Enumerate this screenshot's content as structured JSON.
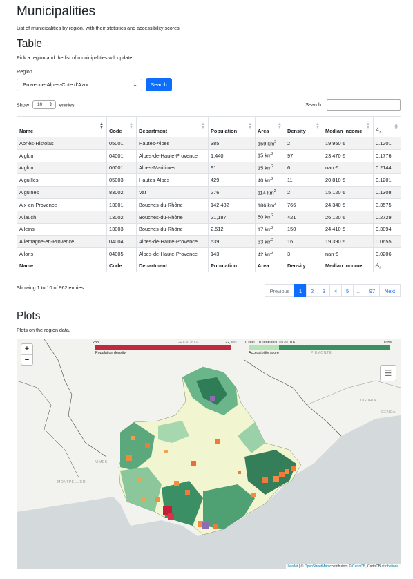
{
  "page": {
    "title": "Municipalities",
    "subtitle": "List of municipalities by region, with their statistics and accessibility scores."
  },
  "table_section": {
    "heading": "Table",
    "description": "Pick a region and the list of municipalities will update.",
    "region_label": "Region",
    "region_value": "Provence-Alpes-Cote d'Azur",
    "search_button": "Search",
    "show_label": "Show",
    "show_value": "10",
    "entries_label": "entries",
    "search_label": "Search:",
    "search_value": ""
  },
  "table": {
    "columns": [
      "Name",
      "Code",
      "Department",
      "Population",
      "Area",
      "Density",
      "Median income",
      "A_i"
    ],
    "rows": [
      [
        "Abriès-Ristolas",
        "05001",
        "Hautes-Alpes",
        "385",
        "159 km²",
        "2",
        "19,950 €",
        "0.1201"
      ],
      [
        "Aiglun",
        "04001",
        "Alpes-de-Haute-Provence",
        "1,440",
        "15 km²",
        "97",
        "23,470 €",
        "0.1776"
      ],
      [
        "Aiglun",
        "06001",
        "Alpes-Maritimes",
        "91",
        "15 km²",
        "6",
        "nan €",
        "0.2144"
      ],
      [
        "Aiguilles",
        "05003",
        "Hautes-Alpes",
        "429",
        "40 km²",
        "11",
        "20,810 €",
        "0.1201"
      ],
      [
        "Aiguines",
        "83002",
        "Var",
        "276",
        "114 km²",
        "2",
        "15,120 €",
        "0.1308"
      ],
      [
        "Aix-en-Provence",
        "13001",
        "Bouches-du-Rhône",
        "142,482",
        "186 km²",
        "766",
        "24,340 €",
        "0.3575"
      ],
      [
        "Allauch",
        "13002",
        "Bouches-du-Rhône",
        "21,187",
        "50 km²",
        "421",
        "26,120 €",
        "0.2729"
      ],
      [
        "Alleins",
        "13003",
        "Bouches-du-Rhône",
        "2,512",
        "17 km²",
        "150",
        "24,410 €",
        "0.3094"
      ],
      [
        "Allemagne-en-Provence",
        "04004",
        "Alpes-de-Haute-Provence",
        "539",
        "33 km²",
        "16",
        "19,390 €",
        "0.0655"
      ],
      [
        "Allons",
        "04005",
        "Alpes-de-Haute-Provence",
        "143",
        "42 km²",
        "3",
        "nan €",
        "0.0206"
      ]
    ],
    "info": "Showing 1 to 10 of 962 entries",
    "pagination": [
      "Previous",
      "1",
      "2",
      "3",
      "4",
      "5",
      "…",
      "97",
      "Next"
    ],
    "active_page": "1"
  },
  "plots_section": {
    "heading": "Plots",
    "description": "Plots on the region data."
  },
  "map": {
    "zoom_in": "+",
    "zoom_out": "−",
    "density_legend": {
      "min": "2",
      "min_overlap": "88",
      "max": "22,103",
      "label": "Population density",
      "color": "#c0293e"
    },
    "accessibility_legend": {
      "ticks": [
        "0.000",
        "0.000",
        "0.000",
        "0.0120.016"
      ],
      "max": "0.056",
      "label": "Accessibility score",
      "color": "#3a8f63"
    },
    "place_labels": [
      "GRENOBLE",
      "PIEMONTE",
      "LIGURIA",
      "NIMES",
      "MONTPELLIER",
      "GENOA"
    ],
    "attribution": {
      "leaflet": "Leaflet",
      "osm": "OpenStreetMap",
      "contributors": "contributors ©",
      "carto": "CartoDB",
      "carto_text": ", CartoDB",
      "attributions": "attributions",
      "sep": "| ©"
    }
  }
}
